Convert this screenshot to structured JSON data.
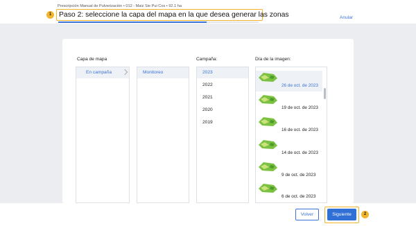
{
  "header": {
    "breadcrumb": "Prescripción Manual de Pulverización • 012 - Maiz Sie Pui Cos • 92.1 ha",
    "step_title": "Paso 2: seleccione la capa del mapa en la que desea generar las zonas",
    "cancel_label": "Anular",
    "progress_fraction": 0.74
  },
  "annotations": {
    "badge_1": "1",
    "badge_2": "2"
  },
  "columns": {
    "layer": {
      "label": "Capa de mapa",
      "items": [
        {
          "label": "En campaña",
          "selected": true
        }
      ]
    },
    "source": {
      "label": "",
      "items": [
        {
          "label": "Monitoreo",
          "selected": true
        }
      ]
    },
    "campaign": {
      "label": "Campaña:",
      "items": [
        {
          "label": "2023",
          "selected": true
        },
        {
          "label": "2022",
          "selected": false
        },
        {
          "label": "2021",
          "selected": false
        },
        {
          "label": "2020",
          "selected": false
        },
        {
          "label": "2019",
          "selected": false
        }
      ]
    },
    "date": {
      "label": "Día de la imagen:",
      "items": [
        {
          "label": "26 de oct. de 2023",
          "selected": true
        },
        {
          "label": "19 de oct. de 2023",
          "selected": false
        },
        {
          "label": "16 de oct. de 2023",
          "selected": false
        },
        {
          "label": "14 de oct. de 2023",
          "selected": false
        },
        {
          "label": "9 de oct. de 2023",
          "selected": false
        },
        {
          "label": "6 de oct. de 2023",
          "selected": false
        }
      ]
    }
  },
  "footer": {
    "back_label": "Volver",
    "next_label": "Siguiente"
  },
  "colors": {
    "accent": "#3a73d8",
    "highlight": "#f1b52c",
    "selected_bg": "#eef1f5",
    "field_green": "#7cc242"
  }
}
